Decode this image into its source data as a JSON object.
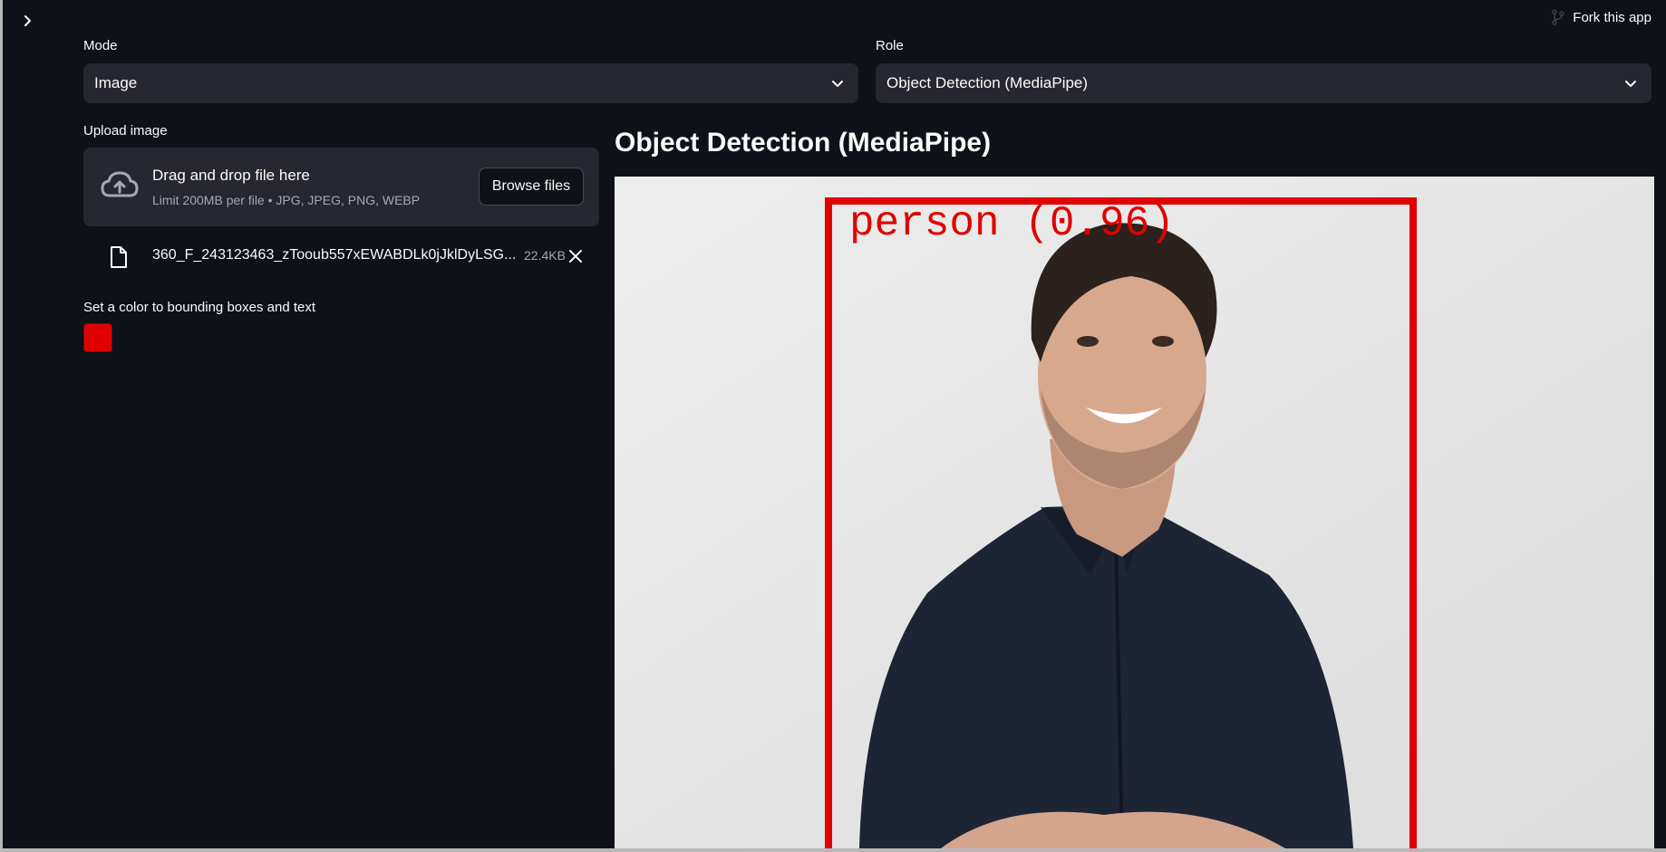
{
  "header": {
    "fork_label": "Fork this app"
  },
  "mode": {
    "label": "Mode",
    "value": "Image"
  },
  "role": {
    "label": "Role",
    "value": "Object Detection (MediaPipe)"
  },
  "uploader": {
    "label": "Upload image",
    "drop_title": "Drag and drop file here",
    "drop_subtitle": "Limit 200MB per file • JPG, JPEG, PNG, WEBP",
    "browse_label": "Browse files",
    "file_name": "360_F_243123463_zTooub557xEWABDLk0jJklDyLSG...",
    "file_size": "22.4KB"
  },
  "color_picker": {
    "label": "Set a color to bounding boxes and text",
    "value": "#e00000"
  },
  "main": {
    "heading": "Object Detection (MediaPipe)",
    "detection_label": "person (0.96)"
  },
  "icons": {
    "sidebar_toggle": "chevron-right-icon",
    "fork": "fork-icon",
    "select": "chevron-down-icon",
    "upload": "cloud-upload-icon",
    "file": "file-icon",
    "remove": "close-icon"
  },
  "colors": {
    "background": "#0e1117",
    "widget": "#262730",
    "muted_text": "#a3a8b8",
    "text": "#fafafa",
    "detection": "#e00000"
  }
}
